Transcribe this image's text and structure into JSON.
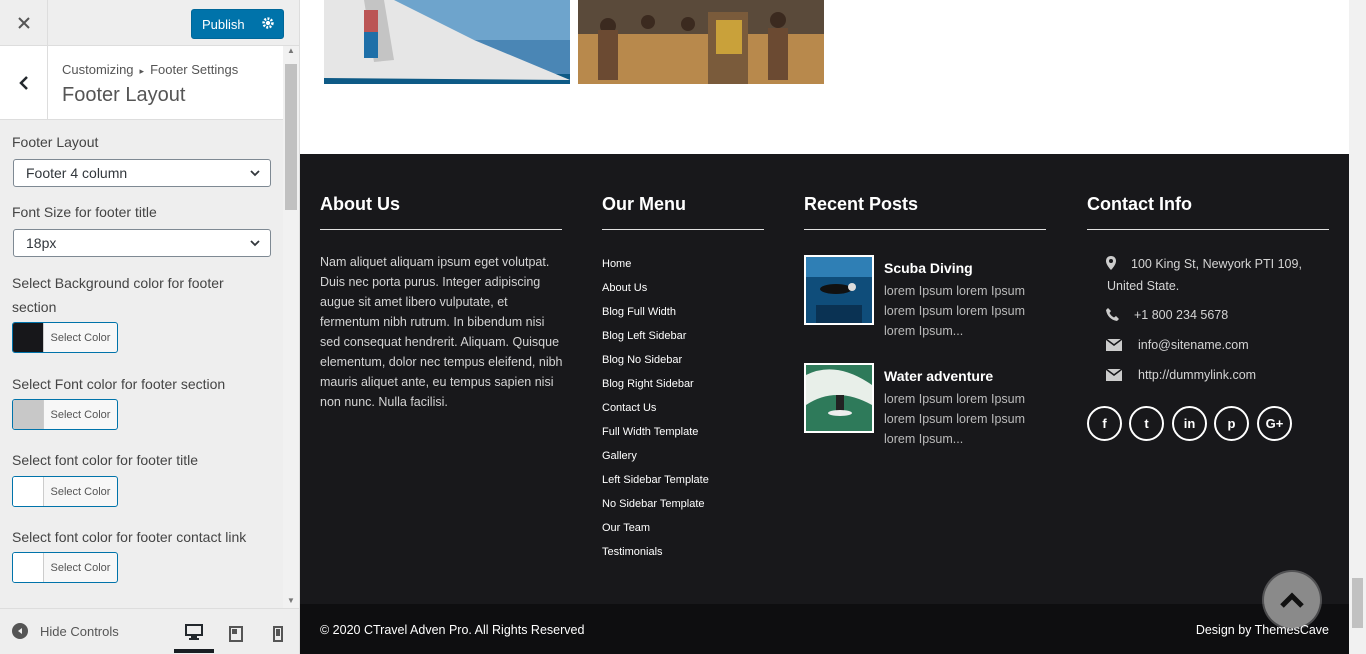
{
  "topbar": {
    "close_icon": "close-icon",
    "publish_label": "Publish"
  },
  "header": {
    "breadcrumb_root": "Customizing",
    "breadcrumb_section": "Footer Settings",
    "title": "Footer Layout"
  },
  "controls": {
    "footer_layout": {
      "label": "Footer Layout",
      "value": "Footer 4 column"
    },
    "font_size": {
      "label": "Font Size for footer title",
      "value": "18px"
    },
    "bg_color": {
      "label": "Select Background color for footer section",
      "button": "Select Color",
      "color": "#17171a"
    },
    "font_color": {
      "label": "Select Font color for footer section",
      "button": "Select Color",
      "color": "#c8c8c8"
    },
    "title_color": {
      "label": "Select font color for footer title",
      "button": "Select Color",
      "color": "#ffffff"
    },
    "contact_color": {
      "label": "Select font color for footer contact link",
      "button": "Select Color",
      "color": "#ffffff"
    }
  },
  "bottom": {
    "hide_controls": "Hide Controls",
    "devices": [
      "desktop",
      "tablet",
      "mobile"
    ],
    "active_device": "desktop"
  },
  "footer": {
    "about": {
      "title": "About Us",
      "text": "Nam aliquet aliquam ipsum eget volutpat. Duis nec porta purus. Integer adipiscing augue sit amet libero vulputate, et fermentum nibh rutrum. In bibendum nisi sed consequat hendrerit. Aliquam. Quisque elementum, dolor nec tempus eleifend, nibh mauris aliquet ante, eu tempus sapien nisi non nunc. Nulla facilisi."
    },
    "menu": {
      "title": "Our Menu",
      "items": [
        "Home",
        "About Us",
        "Blog Full Width",
        "Blog Left Sidebar",
        "Blog No Sidebar",
        "Blog Right Sidebar",
        "Contact Us",
        "Full Width Template",
        "Gallery",
        "Left Sidebar Template",
        "No Sidebar Template",
        "Our Team",
        "Testimonials"
      ]
    },
    "posts": {
      "title": "Recent Posts",
      "items": [
        {
          "title": "Scuba Diving",
          "excerpt": "lorem Ipsum lorem Ipsum lorem Ipsum lorem Ipsum lorem Ipsum..."
        },
        {
          "title": "Water adventure",
          "excerpt": "lorem Ipsum lorem Ipsum lorem Ipsum lorem Ipsum lorem Ipsum..."
        }
      ]
    },
    "contact": {
      "title": "Contact Info",
      "address": "100 King St, Newyork PTI 109, United State.",
      "phone": "+1 800 234 5678",
      "email": "info@sitename.com",
      "website": "http://dummylink.com",
      "social": [
        {
          "icon": "facebook-icon",
          "glyph": "f"
        },
        {
          "icon": "twitter-icon",
          "glyph": "t"
        },
        {
          "icon": "linkedin-icon",
          "glyph": "in"
        },
        {
          "icon": "pinterest-icon",
          "glyph": "p"
        },
        {
          "icon": "google-plus-icon",
          "glyph": "G+"
        }
      ]
    },
    "copyright": "© 2020 CTravel Adven Pro. All Rights Reserved",
    "credit": "Design by ThemesCave"
  },
  "colors": {
    "accent": "#0073aa",
    "footer_bg": "#18181b",
    "bottom_bar": "#0e0e10"
  }
}
